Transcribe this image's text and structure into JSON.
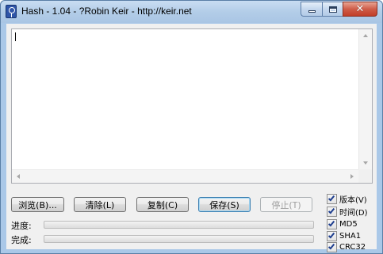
{
  "window": {
    "title": "Hash - 1.04 - ?Robin Keir - http://keir.net",
    "close_glyph": "✕"
  },
  "output": {
    "value": ""
  },
  "buttons": {
    "browse": "浏览(B)...",
    "clear": "清除(L)",
    "copy": "复制(C)",
    "save": "保存(S)",
    "stop": "停止(T)"
  },
  "progress": {
    "progress_label": "进度:",
    "complete_label": "完成:",
    "progress_value": 0,
    "complete_value": 0
  },
  "options": [
    {
      "label": "版本(V)",
      "checked": true
    },
    {
      "label": "时间(D)",
      "checked": true
    },
    {
      "label": "MD5",
      "checked": true
    },
    {
      "label": "SHA1",
      "checked": true
    },
    {
      "label": "CRC32",
      "checked": true
    }
  ],
  "icons": {
    "app": "hash-app-icon",
    "minimize": "minimize-icon",
    "maximize": "maximize-icon",
    "close": "close-icon"
  }
}
